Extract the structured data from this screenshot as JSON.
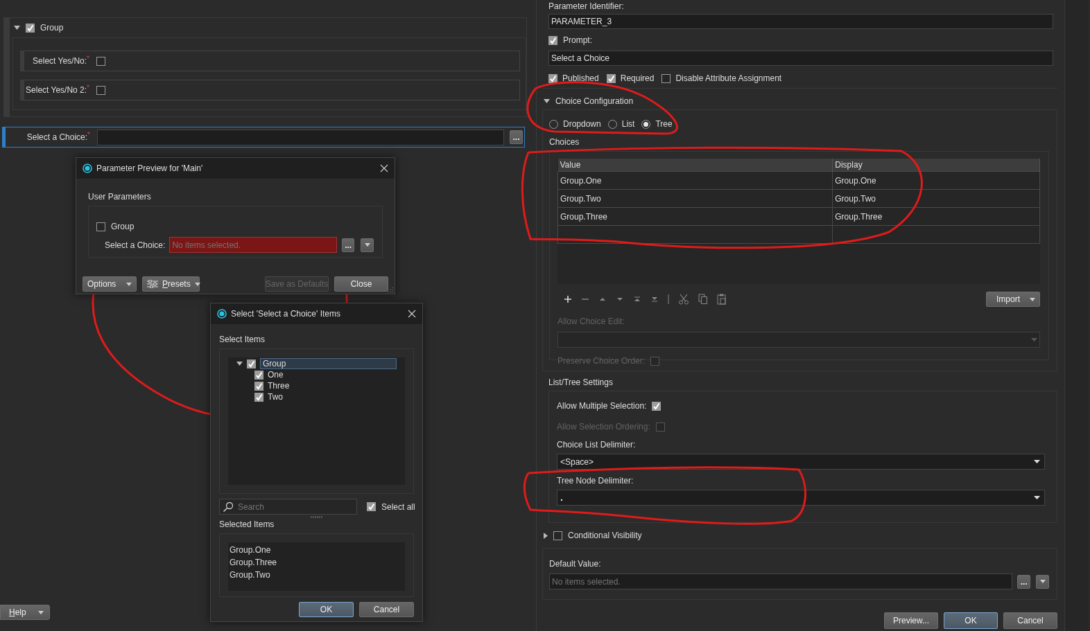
{
  "left_panel": {
    "group": {
      "label": "Group",
      "checked": true,
      "expanded": true,
      "fields": [
        {
          "label": "Select Yes/No:",
          "required_mark": "*",
          "checked": false
        },
        {
          "label": "Select Yes/No 2:",
          "required_mark": "*",
          "checked": false
        }
      ]
    },
    "choice_field": {
      "label": "Select a Choice:",
      "required_mark": "*",
      "selected": true,
      "button": "..."
    },
    "help_button": {
      "label": "Help",
      "mnemonic": true
    }
  },
  "preview_dialog": {
    "title": "Parameter Preview for 'Main'",
    "section": "User Parameters",
    "group": {
      "label": "Group",
      "checked": false
    },
    "choice_field": {
      "label": "Select a Choice:",
      "placeholder": "No items selected.",
      "invalid": true,
      "button": "..."
    },
    "buttons": [
      {
        "label": "Options",
        "kind": "menu",
        "mnemonic": false,
        "disabled": false
      },
      {
        "label": "Presets",
        "kind": "icon-menu",
        "mnemonic": true,
        "disabled": false
      },
      {
        "label": "Save as Defaults",
        "kind": "plain",
        "mnemonic": false,
        "disabled": true
      },
      {
        "label": "Close",
        "kind": "plain",
        "mnemonic": false,
        "disabled": false
      }
    ]
  },
  "select_dialog": {
    "title": "Select 'Select a Choice' Items",
    "section": "Select Items",
    "tree": [
      {
        "label": "Group",
        "checked": true,
        "expanded": true,
        "selected": true,
        "children": [
          {
            "label": "One",
            "checked": true,
            "selected": false
          },
          {
            "label": "Three",
            "checked": true,
            "selected": false
          },
          {
            "label": "Two",
            "checked": true,
            "selected": false
          }
        ]
      }
    ],
    "search": {
      "placeholder": "Search"
    },
    "select_all": {
      "label": "Select all",
      "checked": true
    },
    "selected_section": "Selected Items",
    "selected_items": [
      "Group.One",
      "Group.Three",
      "Group.Two"
    ],
    "buttons": [
      {
        "label": "OK",
        "default": true
      },
      {
        "label": "Cancel",
        "default": false
      }
    ]
  },
  "right_panel": {
    "parameter_identifier": {
      "label": "Parameter Identifier:",
      "value": "PARAMETER_3"
    },
    "prompt": {
      "label": "Prompt:",
      "checked": true,
      "value": "Select a Choice"
    },
    "flags": [
      {
        "label": "Published",
        "checked": true
      },
      {
        "label": "Required",
        "checked": true
      },
      {
        "label": "Disable Attribute Assignment",
        "checked": false
      }
    ],
    "choice_configuration": {
      "title": "Choice Configuration",
      "expanded": true,
      "modes": [
        {
          "label": "Dropdown",
          "selected": false
        },
        {
          "label": "List",
          "selected": false
        },
        {
          "label": "Tree",
          "selected": true
        }
      ],
      "choices_label": "Choices",
      "table": {
        "columns": [
          "Value",
          "Display"
        ],
        "rows": [
          [
            "Group.One",
            "Group.One"
          ],
          [
            "Group.Two",
            "Group.Two"
          ],
          [
            "Group.Three",
            "Group.Three"
          ]
        ]
      },
      "import_button": "Import",
      "allow_choice_edit": {
        "label": "Allow Choice Edit:",
        "disabled": true
      },
      "preserve_choice_order": {
        "label": "Preserve Choice Order:",
        "checked": false,
        "disabled": true
      }
    },
    "list_tree_settings": {
      "title": "List/Tree Settings",
      "allow_multiple_selection": {
        "label": "Allow Multiple Selection:",
        "checked": true,
        "disabled": false
      },
      "allow_selection_ordering": {
        "label": "Allow Selection Ordering:",
        "checked": false,
        "disabled": true
      },
      "choice_list_delimiter": {
        "label": "Choice List Delimiter:",
        "value": "<Space>"
      },
      "tree_node_delimiter": {
        "label": "Tree Node Delimiter:",
        "value": "."
      }
    },
    "conditional_visibility": {
      "label": "Conditional Visibility",
      "checked": false,
      "expanded": false
    },
    "default_value": {
      "label": "Default Value:",
      "placeholder": "No items selected.",
      "button": "..."
    },
    "buttons": [
      {
        "label": "Preview...",
        "default": false
      },
      {
        "label": "OK",
        "default": true
      },
      {
        "label": "Cancel",
        "default": false
      }
    ]
  }
}
